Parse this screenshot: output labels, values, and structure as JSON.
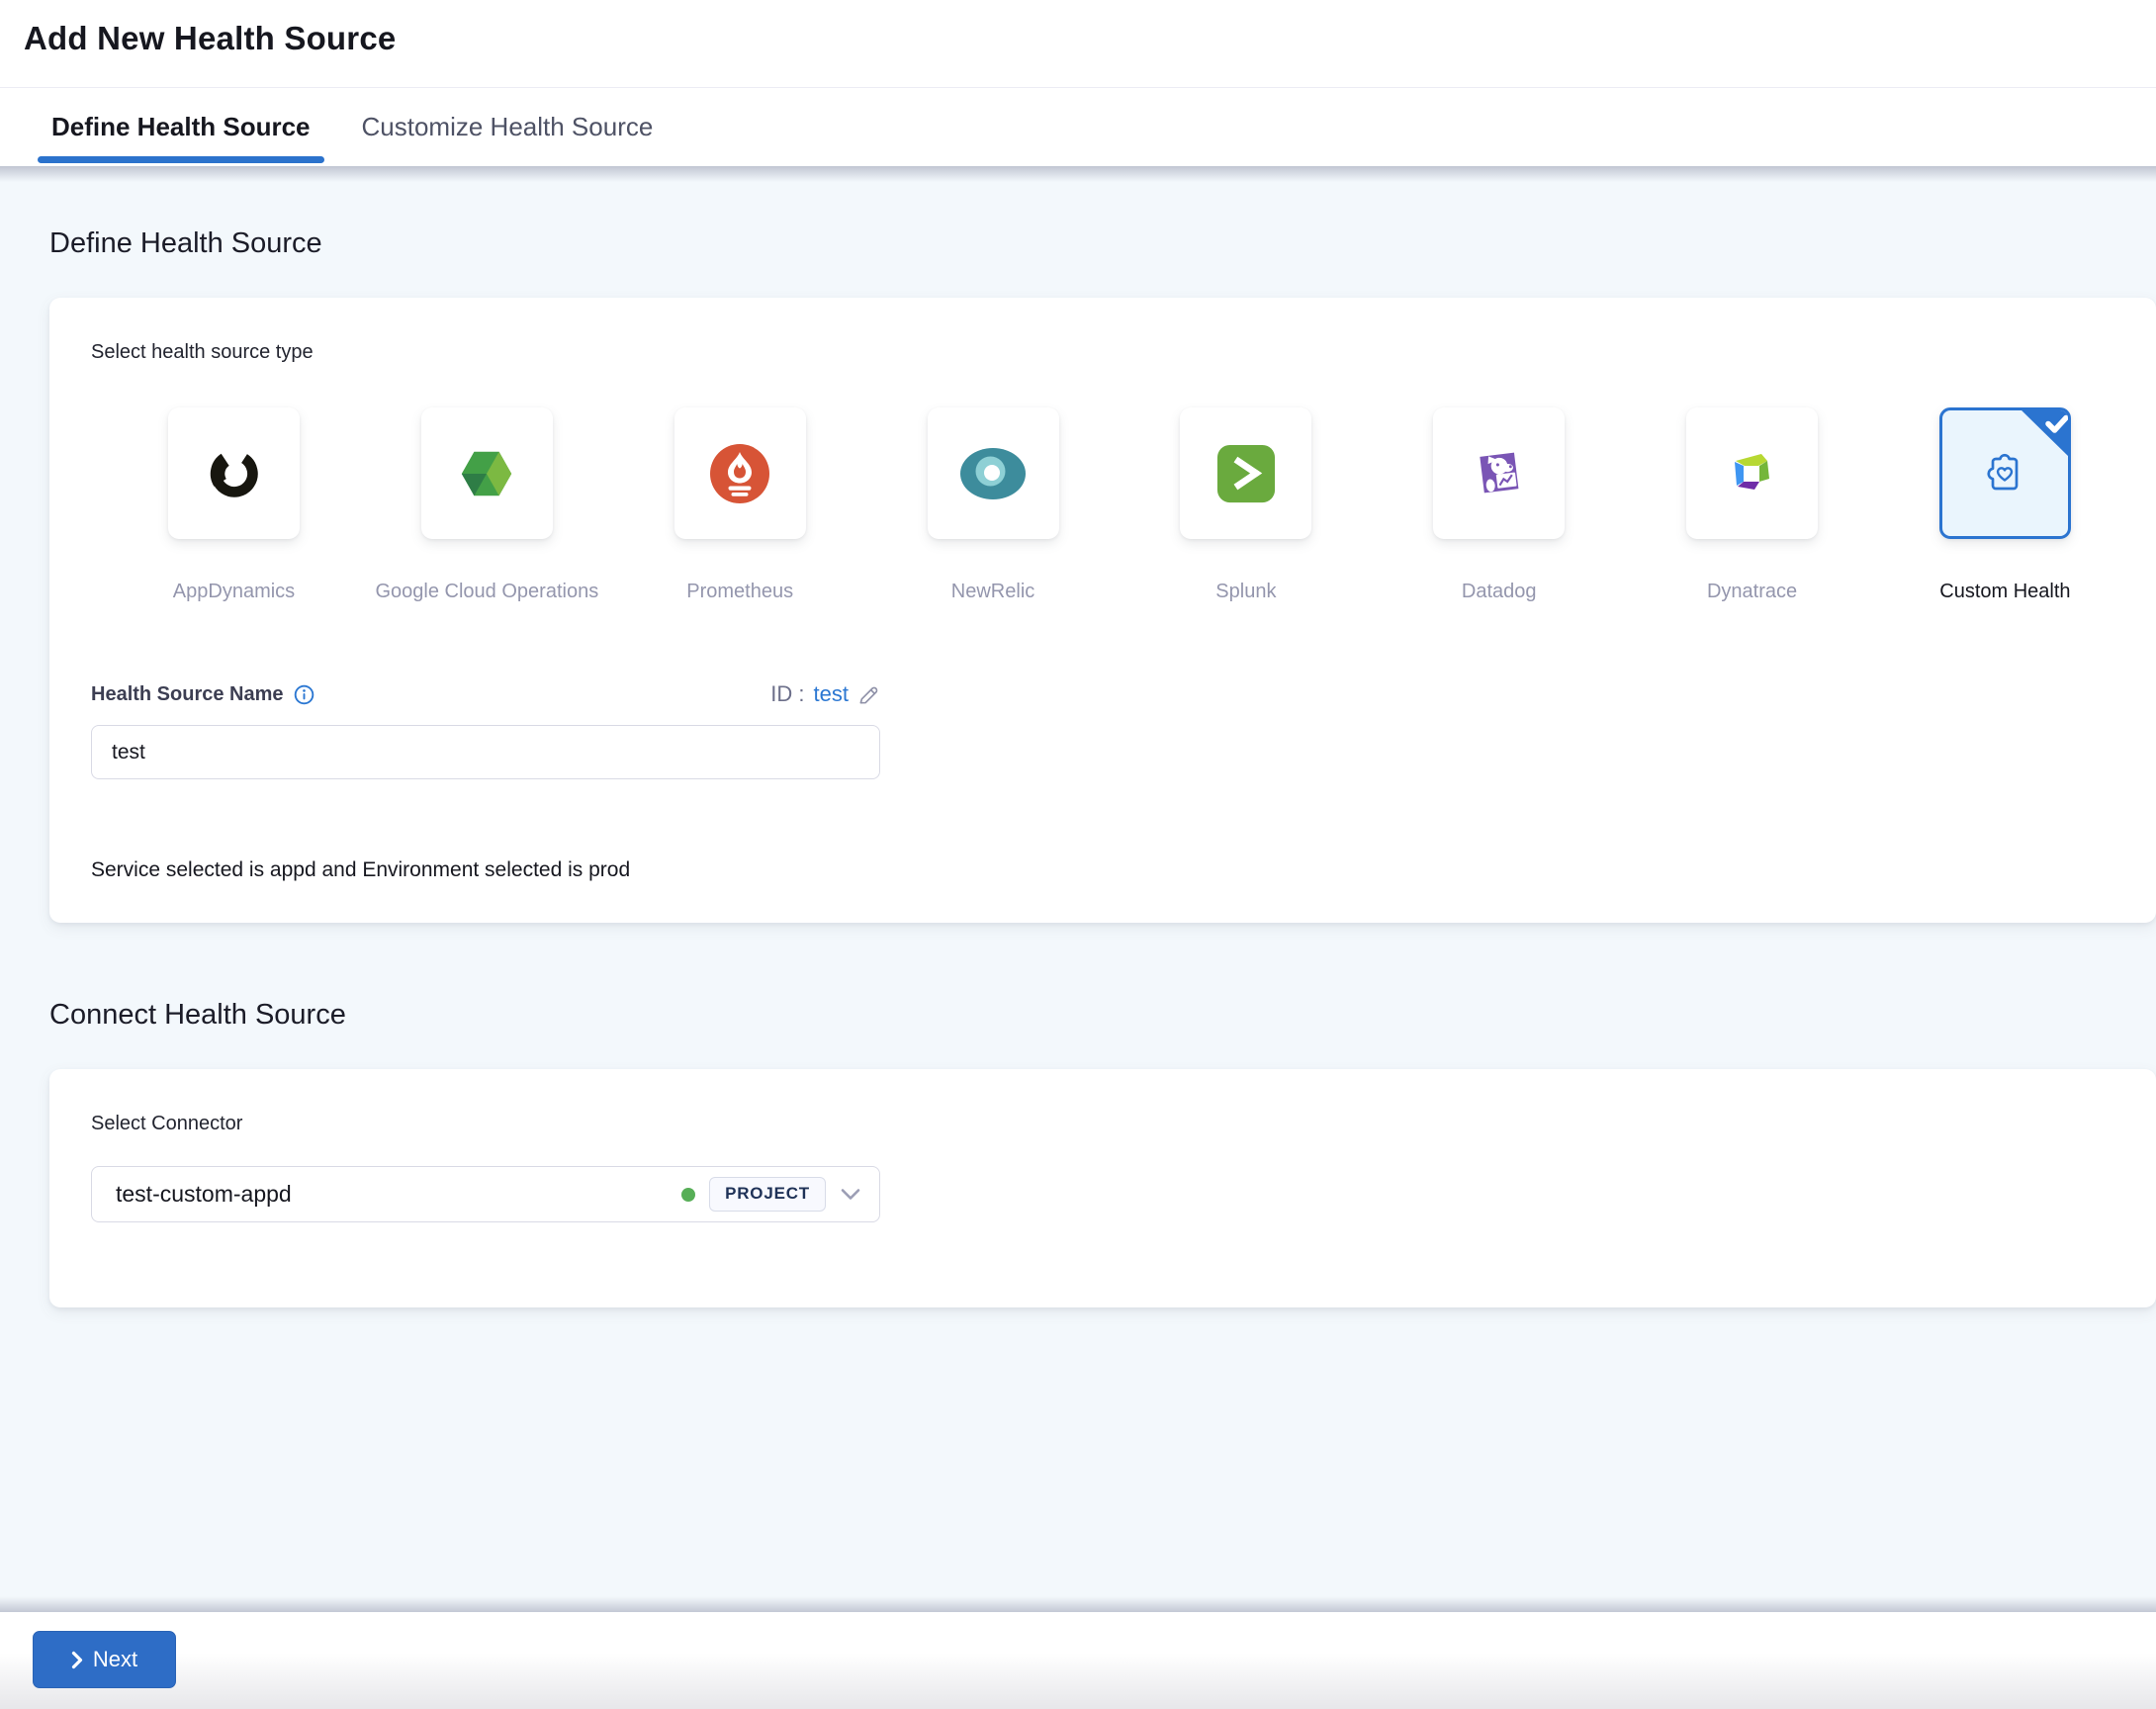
{
  "header": {
    "title": "Add New Health Source",
    "tabs": [
      {
        "label": "Define Health Source",
        "active": true
      },
      {
        "label": "Customize Health Source",
        "active": false
      }
    ]
  },
  "define_section": {
    "heading": "Define Health Source",
    "select_type_label": "Select health source type",
    "source_types": [
      {
        "label": "AppDynamics",
        "icon": "appdynamics-icon",
        "selected": false
      },
      {
        "label": "Google Cloud Operations",
        "icon": "gco-icon",
        "selected": false
      },
      {
        "label": "Prometheus",
        "icon": "prometheus-icon",
        "selected": false
      },
      {
        "label": "NewRelic",
        "icon": "newrelic-icon",
        "selected": false
      },
      {
        "label": "Splunk",
        "icon": "splunk-icon",
        "selected": false
      },
      {
        "label": "Datadog",
        "icon": "datadog-icon",
        "selected": false
      },
      {
        "label": "Dynatrace",
        "icon": "dynatrace-icon",
        "selected": false
      },
      {
        "label": "Custom Health",
        "icon": "customhealth-icon",
        "selected": true
      }
    ],
    "name_field": {
      "label": "Health Source Name",
      "value": "test"
    },
    "id_row": {
      "prefix": "ID :",
      "value": "test"
    },
    "service_env_note": "Service selected is appd and Environment selected is prod"
  },
  "connect_section": {
    "heading": "Connect Health Source",
    "connector_label": "Select Connector",
    "connector": {
      "value": "test-custom-appd",
      "scope": "PROJECT",
      "status": "connected"
    }
  },
  "footer": {
    "next_label": "Next"
  },
  "colors": {
    "page_bg": "#f3f8fc",
    "accent_blue": "#2b74d0",
    "link_blue": "#2b77d2",
    "button_blue": "#2e6dc6",
    "selected_tile_bg": "#eaf5fd",
    "status_green": "#57ae57",
    "appdynamics_black": "#17160f",
    "gco_green": "#43a047",
    "prometheus_orange": "#d75436",
    "newrelic_teal": "#3d8c9c",
    "splunk_green": "#6aaa3e",
    "datadog_purple": "#7a55b5",
    "dynatrace_lime": "#b7d832",
    "dynatrace_blue": "#3f96f2",
    "dynatrace_purple": "#6f2da8",
    "dynatrace_green": "#74b63a"
  }
}
